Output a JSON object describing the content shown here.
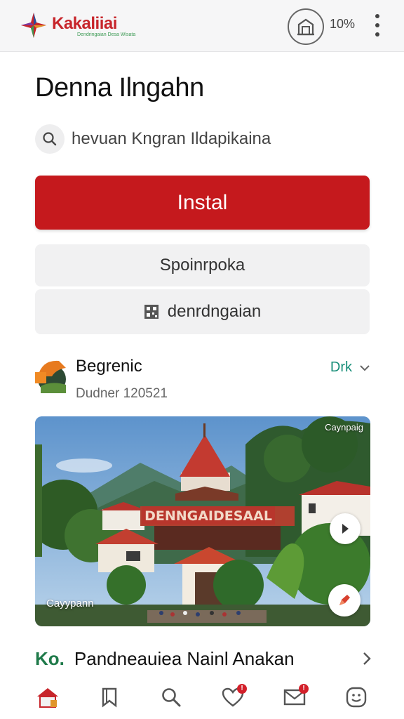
{
  "app": {
    "name": "Kakaliiai",
    "tagline": "Dendringaian Desa Wisata",
    "battery": "10%",
    "accent": "#c5191d",
    "follow_color": "#1a8f7a"
  },
  "header": {
    "title": "Denna Ilngahn",
    "subtitle": "hevuan Kngran Ildapikaina"
  },
  "actions": {
    "install_label": "Instal",
    "secondary_label": "Spoinrpoka",
    "qr_label": "denrdngaian"
  },
  "developer": {
    "name": "Begrenic",
    "meta": "Dudner 120521",
    "follow_label": "Drk"
  },
  "hero": {
    "tag": "Caynpaig",
    "caption": "Cayypann",
    "sign_text": "DENNGAIDESAAL"
  },
  "list": {
    "prefix": "Ko.",
    "title": "Pandneauiea Nainl Anakan"
  },
  "nav": {
    "items": [
      {
        "icon": "home-icon"
      },
      {
        "icon": "bookmark-icon"
      },
      {
        "icon": "search-icon"
      },
      {
        "icon": "heart-icon",
        "badge": "!"
      },
      {
        "icon": "mail-icon",
        "badge": "!"
      },
      {
        "icon": "smile-icon"
      }
    ]
  }
}
